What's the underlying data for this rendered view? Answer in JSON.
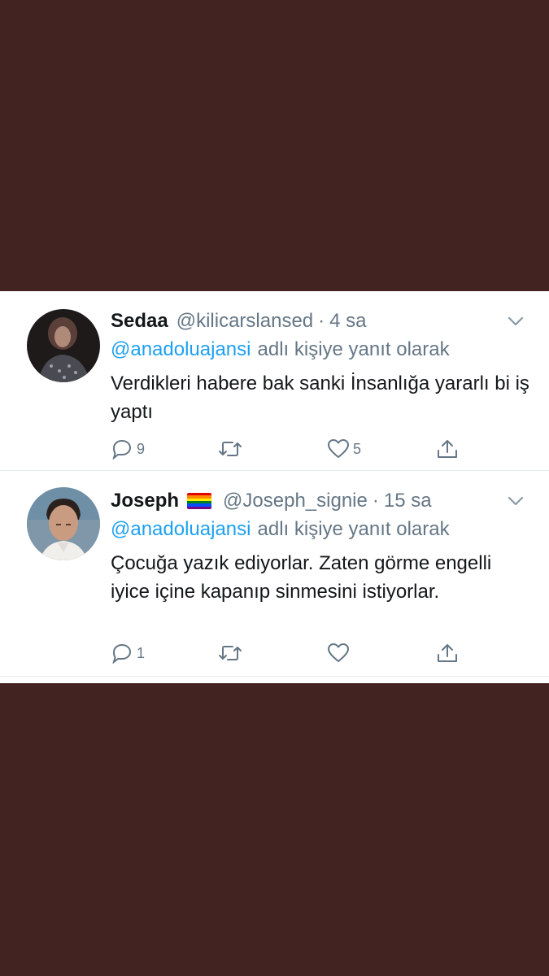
{
  "tweets": [
    {
      "name": "Sedaa",
      "handle": "@kilicarslansed",
      "time_sep": "·",
      "time": "4 sa",
      "reply_mention": "@anadoluajansi",
      "reply_suffix": "adlı kişiye yanıt olarak",
      "text": "Verdikleri habere bak sanki İnsanlığa yararlı bi iş yaptı",
      "reply_count": "9",
      "retweet_count": "",
      "like_count": "5"
    },
    {
      "name": "Joseph",
      "handle": "@Joseph_signie",
      "time_sep": "·",
      "time": "15 sa",
      "reply_mention": "@anadoluajansi",
      "reply_suffix": "adlı kişiye yanıt olarak",
      "text": "Çocuğa yazık ediyorlar. Zaten görme engelli iyice içine kapanıp sinmesini istiyorlar.",
      "reply_count": "1",
      "retweet_count": "",
      "like_count": ""
    }
  ],
  "icons": {
    "reply": "reply-icon",
    "retweet": "retweet-icon",
    "like": "heart-icon",
    "share": "share-icon",
    "caret": "chevron-down-icon",
    "flag": "rainbow-flag-emoji"
  },
  "colors": {
    "background": "#432321",
    "link": "#1da1f2",
    "muted": "#657786",
    "text": "#14171a"
  }
}
